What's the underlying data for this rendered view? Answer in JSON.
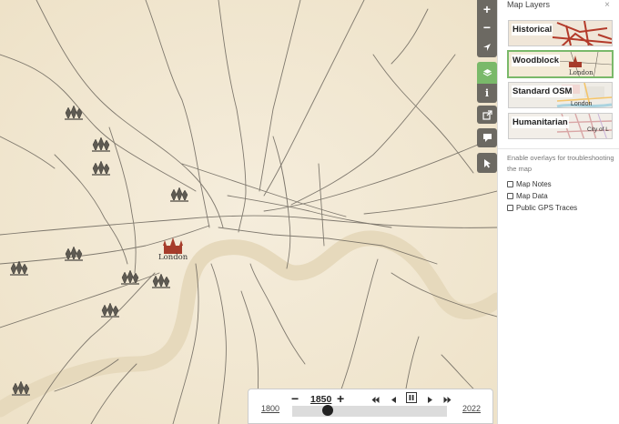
{
  "map": {
    "city_label": "London",
    "colors": {
      "paper": "#f3ead7",
      "river": "#e8dcc0",
      "roads": "#6b655c",
      "church": "#a63c2b"
    }
  },
  "controls": {
    "zoom_in": "+",
    "zoom_out": "−",
    "icons": [
      "plus-icon",
      "minus-icon",
      "locate-arrow-icon",
      "layers-icon",
      "info-icon",
      "share-icon",
      "note-icon",
      "query-cursor-icon"
    ],
    "active": "layers-icon"
  },
  "panel": {
    "title": "Map Layers",
    "close": "×",
    "layers": [
      {
        "label": "Historical",
        "selected": false,
        "thumb_text": ""
      },
      {
        "label": "Woodblock",
        "selected": true,
        "thumb_text": "London"
      },
      {
        "label": "Standard OSM",
        "selected": false,
        "thumb_text": "London"
      },
      {
        "label": "Humanitarian",
        "selected": false,
        "thumb_text": "City of L"
      }
    ],
    "overlay_note": "Enable overlays for troubleshooting the map",
    "overlays": [
      {
        "label": "Map Notes",
        "checked": false
      },
      {
        "label": "Map Data",
        "checked": false
      },
      {
        "label": "Public GPS Traces",
        "checked": false
      }
    ]
  },
  "timeline": {
    "year": "1850",
    "min_year": "1800",
    "max_year": "2022",
    "decrement": "−",
    "increment": "+",
    "position": 0.23,
    "playback_icons": [
      "rewind-fast-icon",
      "step-back-icon",
      "pause-icon",
      "step-forward-icon",
      "forward-fast-icon"
    ]
  }
}
